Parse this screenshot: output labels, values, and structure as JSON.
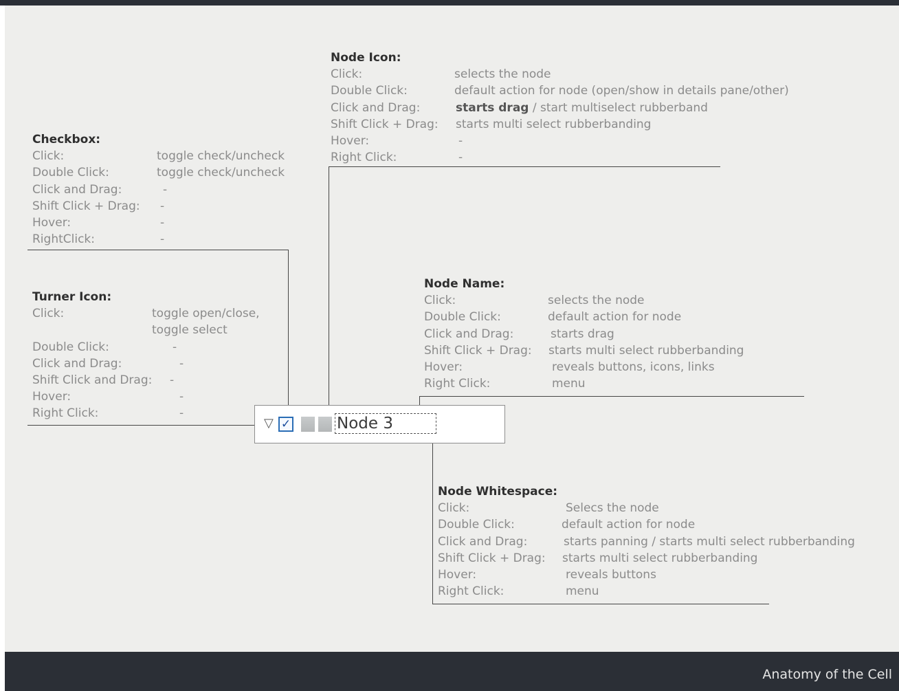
{
  "footer": {
    "title": "Anatomy of the Cell"
  },
  "node": {
    "turner_glyph": "▽",
    "checkbox_glyph": "✓",
    "name": "Node 3"
  },
  "node_icon": {
    "title": "Node Icon:",
    "rows": [
      {
        "label": "Click:",
        "value": "selects the node"
      },
      {
        "label": "Double Click:",
        "value": "default action for node (open/show in details pane/other)"
      },
      {
        "label": "Click and Drag:",
        "value_strong": "starts drag",
        "value": " / start multiselect rubberband"
      },
      {
        "label": "Shift Click + Drag:",
        "value": "starts multi select rubberbanding"
      },
      {
        "label": "Hover:",
        "value": "-"
      },
      {
        "label": "Right Click:",
        "value": "-"
      }
    ]
  },
  "checkbox": {
    "title": "Checkbox:",
    "rows": [
      {
        "label": "Click:",
        "value": "toggle check/uncheck"
      },
      {
        "label": "Double Click:",
        "value": "toggle check/uncheck"
      },
      {
        "label": "Click and Drag:",
        "value": "-"
      },
      {
        "label": "Shift Click + Drag:",
        "value": "-"
      },
      {
        "label": "Hover:",
        "value": "-"
      },
      {
        "label": "RightClick:",
        "value": "-"
      }
    ]
  },
  "turner_icon": {
    "title": "Turner Icon:",
    "rows": [
      {
        "label": "Click:",
        "value": "toggle open/close,",
        "value2": "toggle  select"
      },
      {
        "label": "Double Click:",
        "value": "-"
      },
      {
        "label": "Click and Drag:",
        "value": "-"
      },
      {
        "label": "Shift Click and Drag:",
        "value": "-"
      },
      {
        "label": "Hover:",
        "value": "-"
      },
      {
        "label": "Right Click:",
        "value": "-"
      }
    ]
  },
  "node_name": {
    "title": "Node Name:",
    "rows": [
      {
        "label": "Click:",
        "value": "selects  the node"
      },
      {
        "label": "Double Click:",
        "value": "default action for node"
      },
      {
        "label": "Click and Drag:",
        "value": "starts drag"
      },
      {
        "label": "Shift Click + Drag:",
        "value": "starts multi select rubberbanding"
      },
      {
        "label": "Hover:",
        "value": "reveals buttons, icons, links"
      },
      {
        "label": "Right Click:",
        "value": "menu"
      }
    ]
  },
  "node_whitespace": {
    "title": "Node Whitespace:",
    "rows": [
      {
        "label": "Click:",
        "value": "Selecs the node"
      },
      {
        "label": "Double Click:",
        "value": "default action for node"
      },
      {
        "label": "Click and Drag:",
        "value": "starts panning / starts multi select rubberbanding"
      },
      {
        "label": "Shift Click + Drag:",
        "value": "starts multi select rubberbanding"
      },
      {
        "label": "Hover:",
        "value": "reveals buttons"
      },
      {
        "label": "Right Click:",
        "value": "menu"
      }
    ]
  }
}
